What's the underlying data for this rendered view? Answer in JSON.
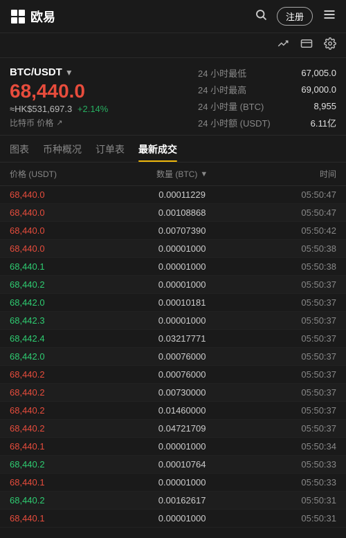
{
  "header": {
    "logo_text": "欧易",
    "register_label": "注册",
    "search_icon": "🔍",
    "menu_icon": "☰"
  },
  "sub_header": {
    "chart_icon": "📈",
    "card_icon": "🪪",
    "gear_icon": "⚙"
  },
  "price_section": {
    "pair": "BTC/USDT",
    "main_price": "68,440.0",
    "hk_price": "≈HK$531,697.3",
    "change": "+2.14%",
    "btc_label": "比特币 价格",
    "stats": [
      {
        "label": "24 小时最低",
        "value": "67,005.0"
      },
      {
        "label": "24 小时最高",
        "value": "69,000.0"
      },
      {
        "label": "24 小时量 (BTC)",
        "value": "8,955"
      },
      {
        "label": "24 小时额 (USDT)",
        "value": "6.11亿"
      }
    ]
  },
  "tabs": [
    {
      "id": "chart",
      "label": "图表"
    },
    {
      "id": "overview",
      "label": "币种概况"
    },
    {
      "id": "orderbook",
      "label": "订单表"
    },
    {
      "id": "trades",
      "label": "最新成交",
      "active": true
    }
  ],
  "trade_list": {
    "col_price": "价格 (USDT)",
    "col_qty": "数量 (BTC)",
    "col_time": "时间",
    "rows": [
      {
        "price": "68,440.0",
        "color": "red",
        "qty": "0.00011229",
        "time": "05:50:47"
      },
      {
        "price": "68,440.0",
        "color": "red",
        "qty": "0.00108868",
        "time": "05:50:47"
      },
      {
        "price": "68,440.0",
        "color": "red",
        "qty": "0.00707390",
        "time": "05:50:42"
      },
      {
        "price": "68,440.0",
        "color": "red",
        "qty": "0.00001000",
        "time": "05:50:38"
      },
      {
        "price": "68,440.1",
        "color": "green",
        "qty": "0.00001000",
        "time": "05:50:38"
      },
      {
        "price": "68,440.2",
        "color": "green",
        "qty": "0.00001000",
        "time": "05:50:37"
      },
      {
        "price": "68,442.0",
        "color": "green",
        "qty": "0.00010181",
        "time": "05:50:37"
      },
      {
        "price": "68,442.3",
        "color": "green",
        "qty": "0.00001000",
        "time": "05:50:37"
      },
      {
        "price": "68,442.4",
        "color": "green",
        "qty": "0.03217771",
        "time": "05:50:37"
      },
      {
        "price": "68,442.0",
        "color": "green",
        "qty": "0.00076000",
        "time": "05:50:37"
      },
      {
        "price": "68,440.2",
        "color": "red",
        "qty": "0.00076000",
        "time": "05:50:37"
      },
      {
        "price": "68,440.2",
        "color": "red",
        "qty": "0.00730000",
        "time": "05:50:37"
      },
      {
        "price": "68,440.2",
        "color": "red",
        "qty": "0.01460000",
        "time": "05:50:37"
      },
      {
        "price": "68,440.2",
        "color": "red",
        "qty": "0.04721709",
        "time": "05:50:37"
      },
      {
        "price": "68,440.1",
        "color": "red",
        "qty": "0.00001000",
        "time": "05:50:34"
      },
      {
        "price": "68,440.2",
        "color": "green",
        "qty": "0.00010764",
        "time": "05:50:33"
      },
      {
        "price": "68,440.1",
        "color": "red",
        "qty": "0.00001000",
        "time": "05:50:33"
      },
      {
        "price": "68,440.2",
        "color": "green",
        "qty": "0.00162617",
        "time": "05:50:31"
      },
      {
        "price": "68,440.1",
        "color": "red",
        "qty": "0.00001000",
        "time": "05:50:31"
      }
    ]
  }
}
